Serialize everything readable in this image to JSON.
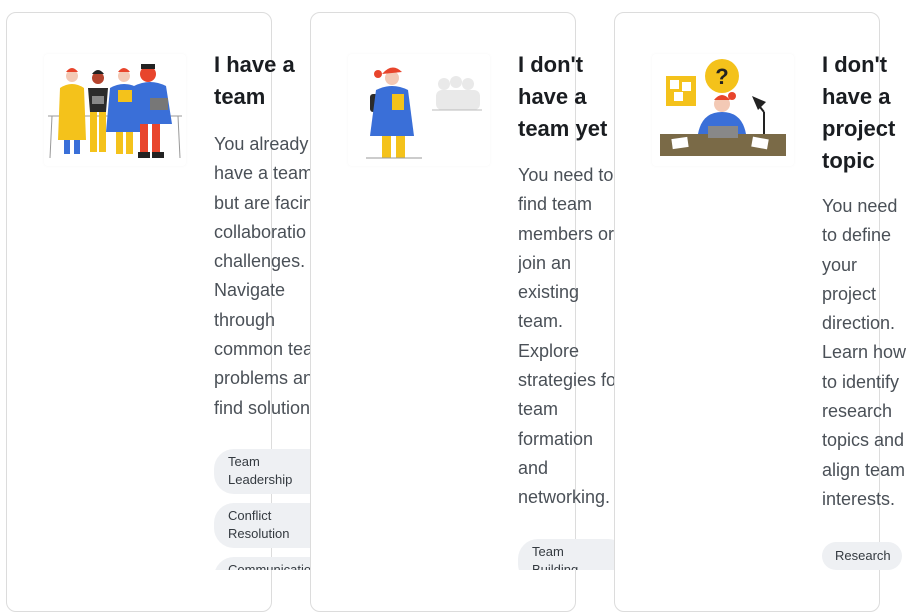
{
  "cards": [
    {
      "title": "I have a\nteam",
      "description": "You already\nhave a team\nbut are facin\ncollaboratio\nchallenges.\nNavigate\nthrough\ncommon tea\nproblems an\nfind solution",
      "tags": [
        "Team\nLeadership",
        "Conflict\nResolution",
        "Communicatio"
      ],
      "illustration": "team-group-illustration"
    },
    {
      "title": "I don't\nhave a\nteam yet",
      "description": "You need to\nfind team\nmembers or\njoin an\nexisting\nteam.\nExplore\nstrategies fo\nteam\nformation\nand\nnetworking.",
      "tags": [
        "Team\nBuilding"
      ],
      "illustration": "lone-person-illustration"
    },
    {
      "title": "I don't\nhave a\nproject\ntopic",
      "description": "You need\nto define\nyour\nproject\ndirection.\nLearn how\nto identify\nresearch\ntopics and\nalign team\ninterests.",
      "tags": [
        "Research"
      ],
      "illustration": "thinking-desk-illustration"
    }
  ],
  "colors": {
    "yellow": "#f4c21b",
    "blue": "#3a6fd8",
    "red": "#e8452c",
    "dark": "#2b2b2b"
  }
}
